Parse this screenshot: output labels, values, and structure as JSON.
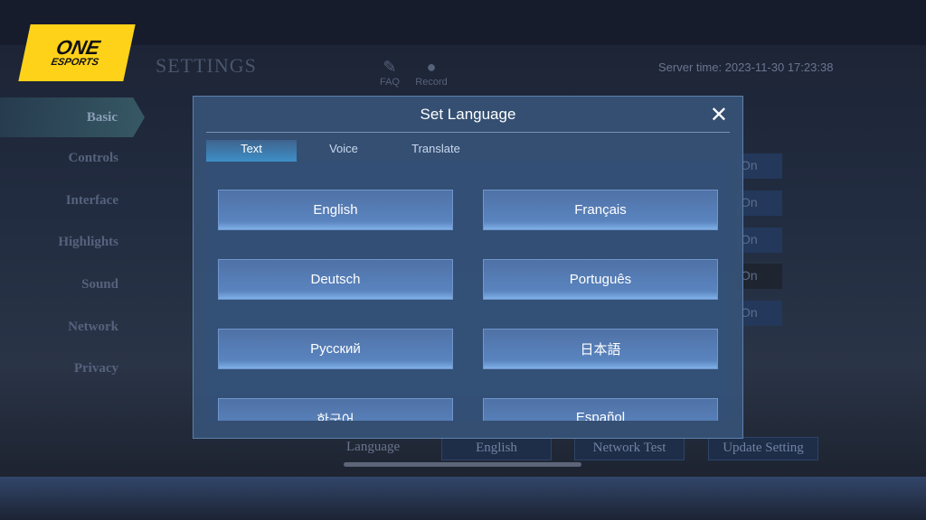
{
  "logo": {
    "line1": "ONE",
    "line2": "ESPORTS"
  },
  "header": {
    "title": "SETTINGS",
    "faq": "FAQ",
    "record": "Record",
    "server_time": "Server time: 2023-11-30 17:23:38"
  },
  "sidebar": {
    "items": [
      {
        "label": "Basic",
        "active": true
      },
      {
        "label": "Controls"
      },
      {
        "label": "Interface"
      },
      {
        "label": "Highlights"
      },
      {
        "label": "Sound"
      },
      {
        "label": "Network"
      },
      {
        "label": "Privacy"
      }
    ]
  },
  "background": {
    "toggles": [
      "On",
      "On",
      "On",
      "On",
      "On"
    ]
  },
  "modal": {
    "title": "Set Language",
    "tabs": [
      {
        "label": "Text",
        "active": true
      },
      {
        "label": "Voice"
      },
      {
        "label": "Translate"
      }
    ],
    "languages": [
      "English",
      "Français",
      "Deutsch",
      "Português",
      "Русский",
      "日本語",
      "한국어",
      "Español"
    ]
  },
  "footer": {
    "language_label": "Language",
    "language_value": "English",
    "network_test": "Network Test",
    "update_setting": "Update Setting"
  }
}
